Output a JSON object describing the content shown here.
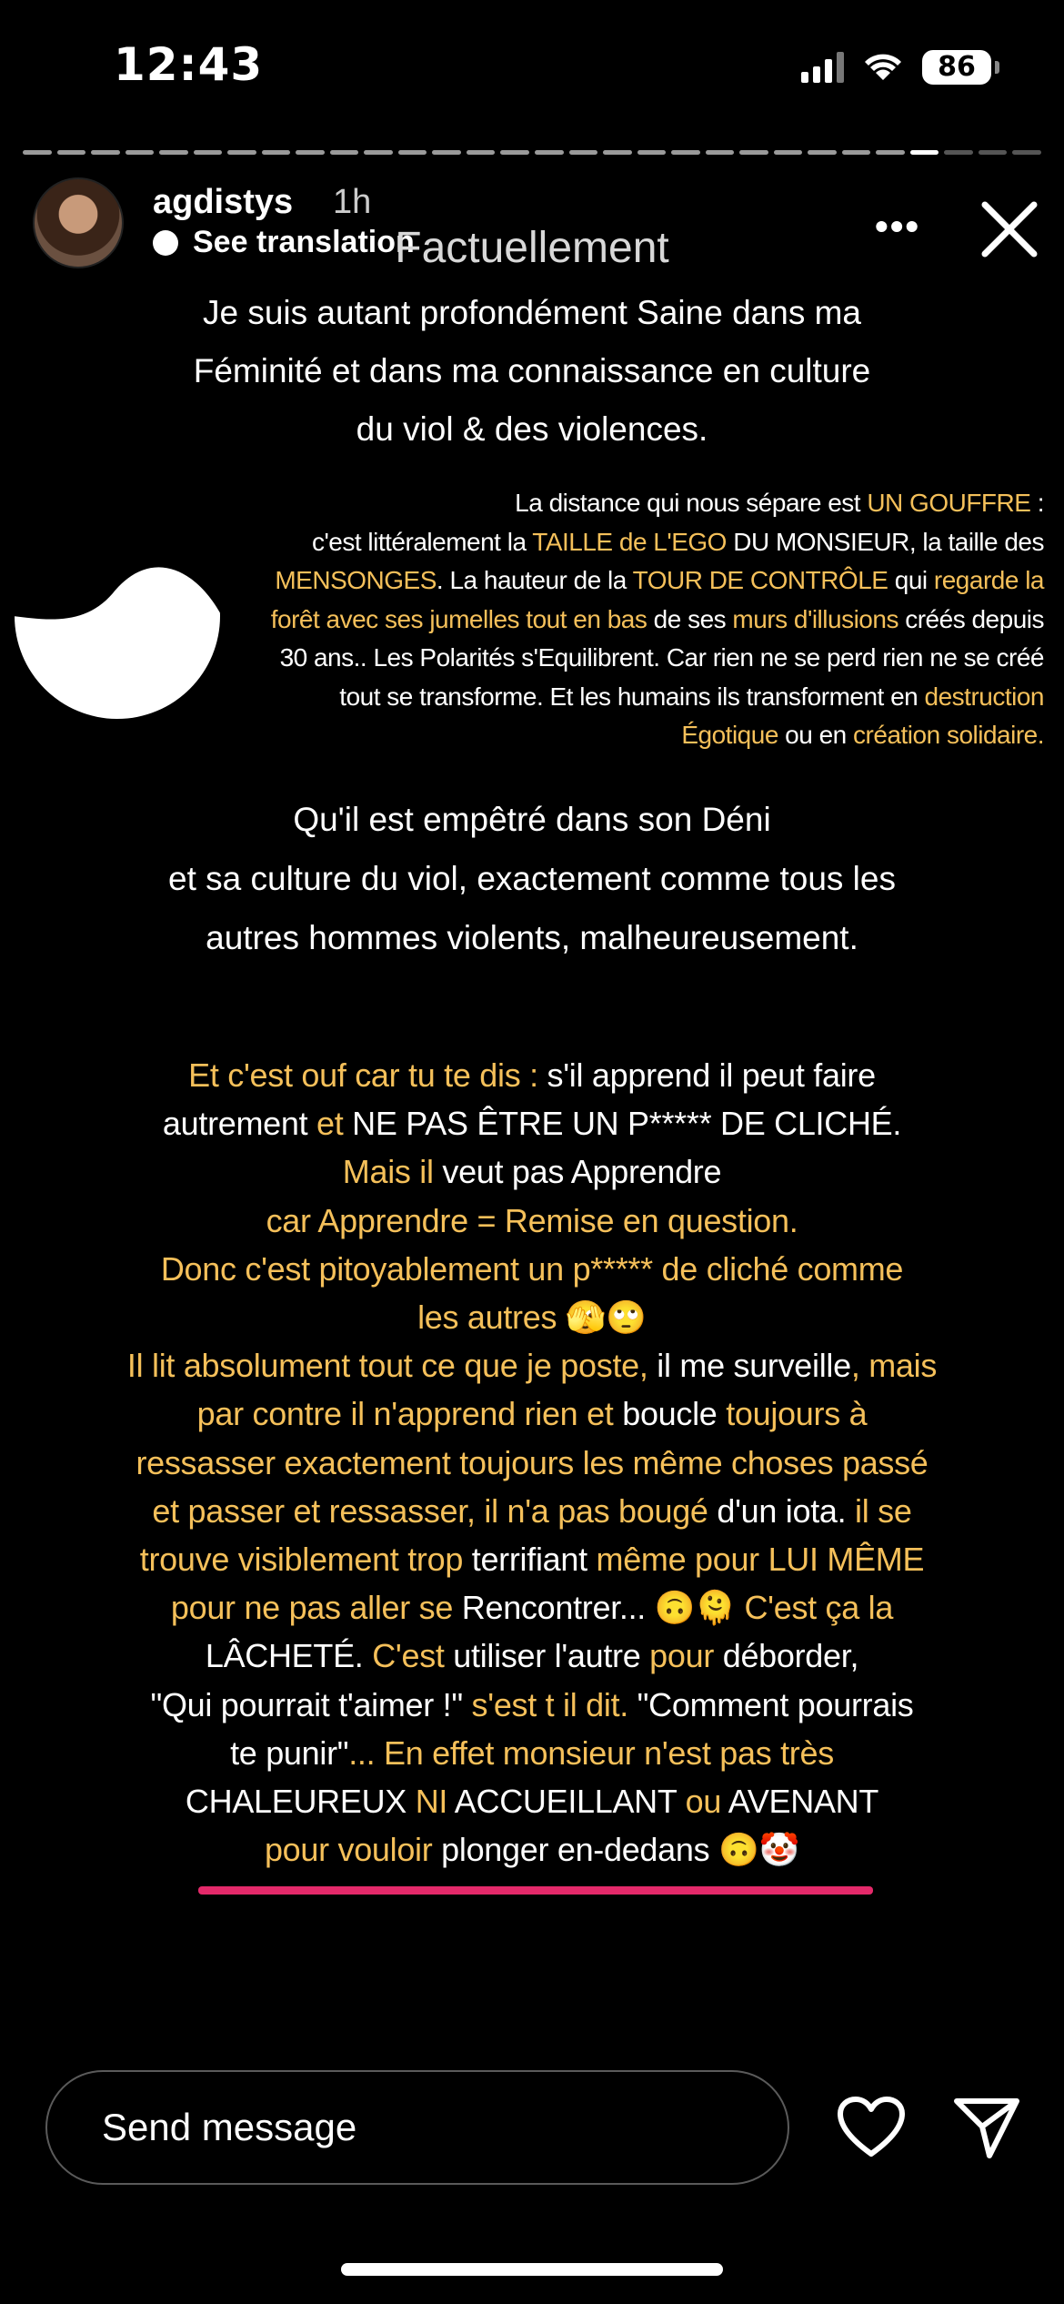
{
  "status_bar": {
    "time": "12:43",
    "battery": "86"
  },
  "story": {
    "username": "agdistys",
    "posted": "1h",
    "see_translation": "See translation",
    "title": "Factuellement"
  },
  "content": {
    "p1": [
      [
        {
          "t": "Je suis autant profondément Saine dans ma",
          "y": false
        }
      ],
      [
        {
          "t": "Féminité et dans ma connaissance en culture",
          "y": false
        }
      ],
      [
        {
          "t": "du viol & des violences.",
          "y": false
        }
      ]
    ],
    "small": [
      [
        {
          "t": "La distance qui nous sépare est ",
          "y": false
        },
        {
          "t": "UN GOUFFRE",
          "y": true
        },
        {
          "t": " :",
          "y": false
        }
      ],
      [
        {
          "t": "c'est littéralement la ",
          "y": false
        },
        {
          "t": "TAILLE de L'EGO",
          "y": true
        },
        {
          "t": " DU MONSIEUR, la taille des",
          "y": false
        }
      ],
      [
        {
          "t": "MENSONGES",
          "y": true
        },
        {
          "t": ". La hauteur de la ",
          "y": false
        },
        {
          "t": "TOUR DE CONTRÔLE",
          "y": true
        },
        {
          "t": " qui ",
          "y": false
        },
        {
          "t": "regarde la",
          "y": true
        }
      ],
      [
        {
          "t": "forêt avec ses jumelles tout en bas",
          "y": true
        },
        {
          "t": " de ses ",
          "y": false
        },
        {
          "t": "murs d'illusions",
          "y": true
        },
        {
          "t": " créés depuis",
          "y": false
        }
      ],
      [
        {
          "t": "30 ans.. Les Polarités s'Equilibrent. Car rien ne se perd rien ne se créé",
          "y": false
        }
      ],
      [
        {
          "t": "tout se transforme.  Et les humains ils transforment en ",
          "y": false
        },
        {
          "t": "destruction",
          "y": true
        }
      ],
      [
        {
          "t": "Égotique",
          "y": true
        },
        {
          "t": " ou en ",
          "y": false
        },
        {
          "t": "création solidaire.",
          "y": true
        }
      ]
    ],
    "p2": [
      [
        {
          "t": "Qu'il est empêtré dans son Déni",
          "y": false
        }
      ],
      [
        {
          "t": "et sa culture du viol, exactement comme tous les",
          "y": false
        }
      ],
      [
        {
          "t": "autres hommes violents, malheureusement.",
          "y": false
        }
      ]
    ],
    "p3": [
      [
        {
          "t": "Et c'est ouf car tu te dis :",
          "y": true
        },
        {
          "t": " s'il apprend il peut faire",
          "y": false
        }
      ],
      [
        {
          "t": "autrement ",
          "y": false
        },
        {
          "t": "et",
          "y": true
        },
        {
          "t": " NE PAS ÊTRE UN P***** DE CLICHÉ.",
          "y": false
        }
      ],
      [
        {
          "t": "Mais il",
          "y": true
        },
        {
          "t": " veut pas Apprendre",
          "y": false
        }
      ],
      [
        {
          "t": "car Apprendre = Remise en question.",
          "y": true
        }
      ],
      [
        {
          "t": "Donc c'est pitoyablement un p***** de cliché comme",
          "y": true
        }
      ],
      [
        {
          "t": "les autres ",
          "y": true
        },
        {
          "t": "🫣🙄",
          "y": false
        }
      ],
      [
        {
          "t": "Il lit absolument tout ce que je poste,",
          "y": true
        },
        {
          "t": " il me surveille",
          "y": false
        },
        {
          "t": ", mais",
          "y": true
        }
      ],
      [
        {
          "t": "par contre il n'apprend rien et",
          "y": true
        },
        {
          "t": " boucle ",
          "y": false
        },
        {
          "t": "toujours à",
          "y": true
        }
      ],
      [
        {
          "t": "ressasser exactement toujours les même choses passé",
          "y": true
        }
      ],
      [
        {
          "t": "et passer et ressasser, il n'a pas bougé",
          "y": true
        },
        {
          "t": " d'un iota.",
          "y": false
        },
        {
          "t": " il se",
          "y": true
        }
      ],
      [
        {
          "t": "trouve visiblement trop",
          "y": true
        },
        {
          "t": " terrifiant ",
          "y": false
        },
        {
          "t": "même pour LUI MÊME",
          "y": true
        }
      ],
      [
        {
          "t": "pour ne pas aller se",
          "y": true
        },
        {
          "t": " Rencontrer... 🙃🫠 ",
          "y": false
        },
        {
          "t": "C'est ça la",
          "y": true
        }
      ],
      [
        {
          "t": "LÂCHETÉ.",
          "y": false
        },
        {
          "t": " C'est",
          "y": true
        },
        {
          "t": " utiliser l'autre ",
          "y": false
        },
        {
          "t": "pour",
          "y": true
        },
        {
          "t": " déborder,",
          "y": false
        }
      ],
      [
        {
          "t": "\"Qui pourrait t'aimer !\"",
          "y": false
        },
        {
          "t": " s'est t il dit.",
          "y": true
        },
        {
          "t": " \"Comment pourrais",
          "y": false
        }
      ],
      [
        {
          "t": "te punir\"",
          "y": false
        },
        {
          "t": "... En effet monsieur n'est pas très",
          "y": true
        }
      ],
      [
        {
          "t": "CHALEUREUX ",
          "y": false
        },
        {
          "t": "NI",
          "y": true
        },
        {
          "t": " ACCUEILLANT ",
          "y": false
        },
        {
          "t": "ou",
          "y": true
        },
        {
          "t": " AVENANT",
          "y": false
        }
      ],
      [
        {
          "t": "pour vouloir",
          "y": true
        },
        {
          "t": " plonger en-dedans 🙃🤡",
          "y": false
        }
      ]
    ]
  },
  "footer": {
    "message_placeholder": "Send message"
  },
  "colors": {
    "highlight": "#f5c05a",
    "underline": "#e4296a"
  },
  "icons": [
    "signal-icon",
    "wifi-icon",
    "battery-icon",
    "more-icon",
    "close-icon",
    "yin-yang-icon",
    "heart-icon",
    "send-icon"
  ]
}
